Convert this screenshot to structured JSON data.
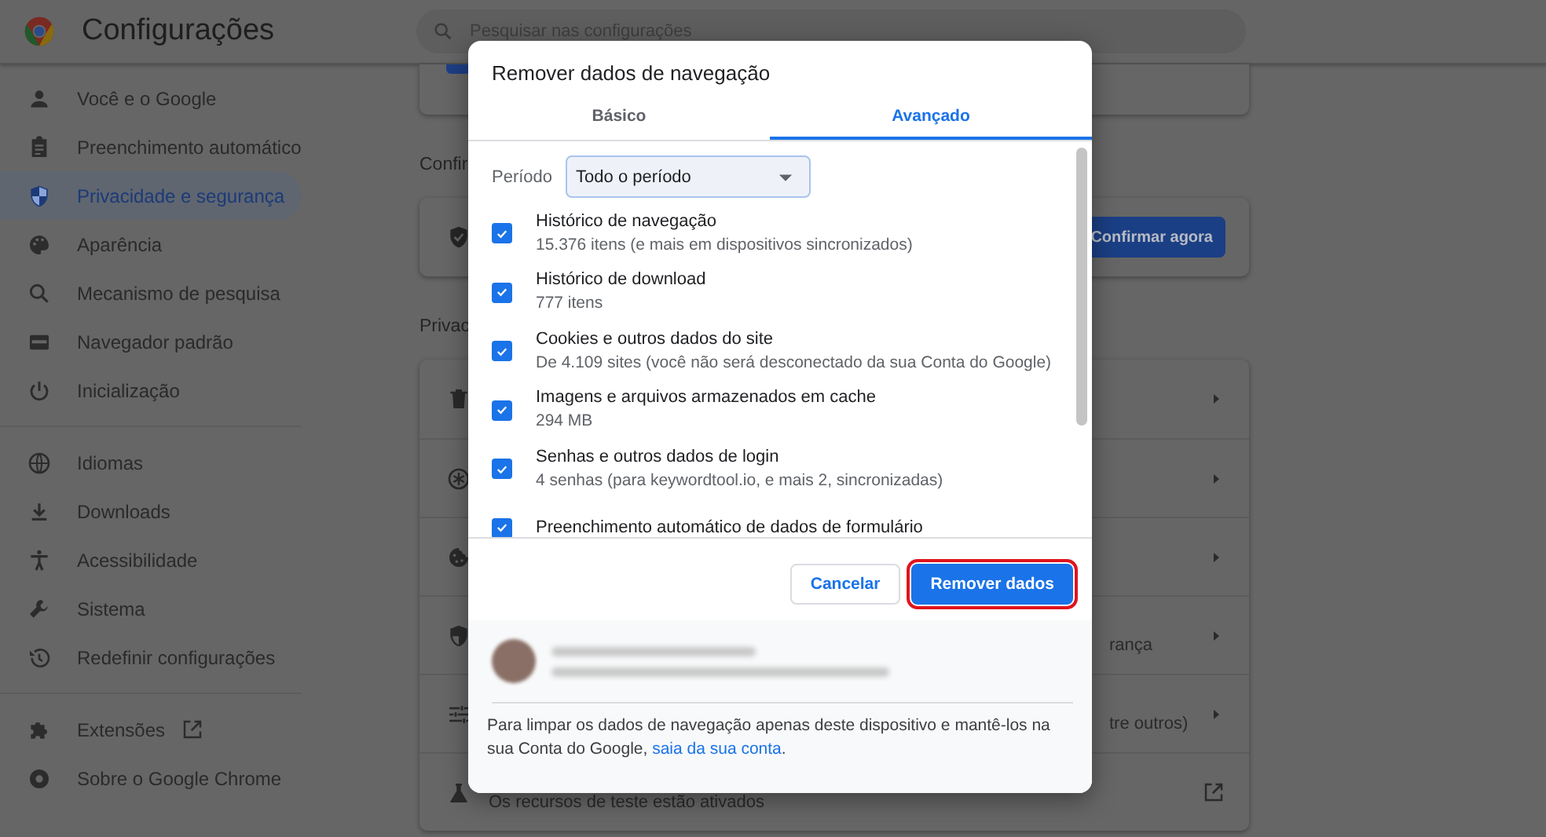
{
  "header": {
    "title": "Configurações",
    "search": {
      "placeholder": "Pesquisar nas configurações"
    }
  },
  "sidebar": {
    "groups": [
      [
        {
          "label": "Você e o Google",
          "selected": false,
          "external": false
        },
        {
          "label": "Preenchimento automático",
          "selected": false,
          "external": false
        },
        {
          "label": "Privacidade e segurança",
          "selected": true,
          "external": false
        },
        {
          "label": "Aparência",
          "selected": false,
          "external": false
        },
        {
          "label": "Mecanismo de pesquisa",
          "selected": false,
          "external": false
        },
        {
          "label": "Navegador padrão",
          "selected": false,
          "external": false
        },
        {
          "label": "Inicialização",
          "selected": false,
          "external": false
        }
      ],
      [
        {
          "label": "Idiomas",
          "selected": false,
          "external": false
        },
        {
          "label": "Downloads",
          "selected": false,
          "external": false
        },
        {
          "label": "Acessibilidade",
          "selected": false,
          "external": false
        },
        {
          "label": "Sistema",
          "selected": false,
          "external": false
        },
        {
          "label": "Redefinir configurações",
          "selected": false,
          "external": false
        }
      ],
      [
        {
          "label": "Extensões",
          "selected": false,
          "external": true
        },
        {
          "label": "Sobre o Google Chrome",
          "selected": false,
          "external": false
        }
      ]
    ]
  },
  "main": {
    "headings": [
      "Confir",
      "Privac"
    ],
    "check_card": {
      "button": "Confirmar agora"
    },
    "privacy_rows": [
      {
        "kind": "submenu"
      },
      {
        "kind": "submenu"
      },
      {
        "kind": "submenu"
      },
      {
        "kind": "submenu",
        "text": "rança"
      },
      {
        "kind": "submenu",
        "text": "tre outros)"
      },
      {
        "kind": "external",
        "text": "Os recursos de teste estão ativados"
      }
    ]
  },
  "dialog": {
    "title": "Remover dados de navegação",
    "tabs": [
      {
        "label": "Básico",
        "selected": false
      },
      {
        "label": "Avançado",
        "selected": true
      }
    ],
    "period": {
      "label": "Período",
      "value": "Todo o período"
    },
    "items": [
      {
        "title": "Histórico de navegação",
        "detail": "15.376 itens (e mais em dispositivos sincronizados)",
        "checked": true
      },
      {
        "title": "Histórico de download",
        "detail": "777 itens",
        "checked": true
      },
      {
        "title": "Cookies e outros dados do site",
        "detail": "De 4.109 sites (você não será desconectado da sua Conta do Google)",
        "checked": true
      },
      {
        "title": "Imagens e arquivos armazenados em cache",
        "detail": "294 MB",
        "checked": true
      },
      {
        "title": "Senhas e outros dados de login",
        "detail": "4 senhas (para keywordtool.io, e mais 2, sincronizadas)",
        "checked": true
      },
      {
        "title": "Preenchimento automático de dados de formulário",
        "checked": true
      }
    ],
    "buttons": [
      {
        "label": "Cancelar",
        "kind": "secondary",
        "highlighted": false
      },
      {
        "label": "Remover dados",
        "kind": "primary",
        "highlighted": true
      }
    ],
    "footer": {
      "text": "Para limpar os dados de navegação apenas deste dispositivo e mantê-los na sua Conta do Google,",
      "link": "saia da sua conta",
      "after": "."
    }
  }
}
